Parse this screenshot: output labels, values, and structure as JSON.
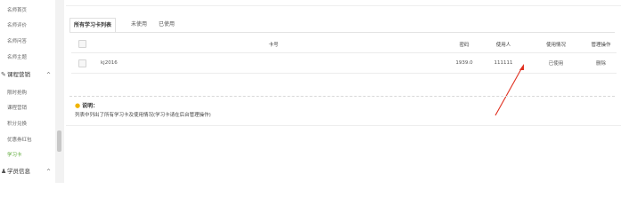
{
  "sidebar": {
    "items_top": [
      {
        "label": "名师首页"
      },
      {
        "label": "名师评价"
      },
      {
        "label": "名师问答"
      },
      {
        "label": "名师主题"
      }
    ],
    "group_course": {
      "label": "课程营销",
      "chevron": "^"
    },
    "course_items": [
      {
        "label": "限时抢购"
      },
      {
        "label": "课程营销"
      },
      {
        "label": "积分兑换"
      },
      {
        "label": "优惠券红包"
      },
      {
        "label": "学习卡",
        "active": true
      }
    ],
    "group_student": {
      "label": "学员信息",
      "chevron": "^"
    }
  },
  "tabs": [
    {
      "label": "所有学习卡列表",
      "active": true
    },
    {
      "label": "未使用"
    },
    {
      "label": "已使用"
    }
  ],
  "table": {
    "headers": {
      "card_no": "卡号",
      "password": "密码",
      "user": "使用人",
      "status": "使用情况",
      "action": "管理操作"
    },
    "rows": [
      {
        "card_no": "kj2016",
        "password": "1939.0",
        "user": "111111",
        "status": "已使用",
        "action": "删除"
      }
    ]
  },
  "note": {
    "title": "说明：",
    "text": "列表中列出了所有学习卡及使用情况(学习卡请在后台管理操作)"
  },
  "colors": {
    "accent_green": "#5aa834",
    "arrow_red": "#e03020",
    "bulb": "#f0b400"
  }
}
